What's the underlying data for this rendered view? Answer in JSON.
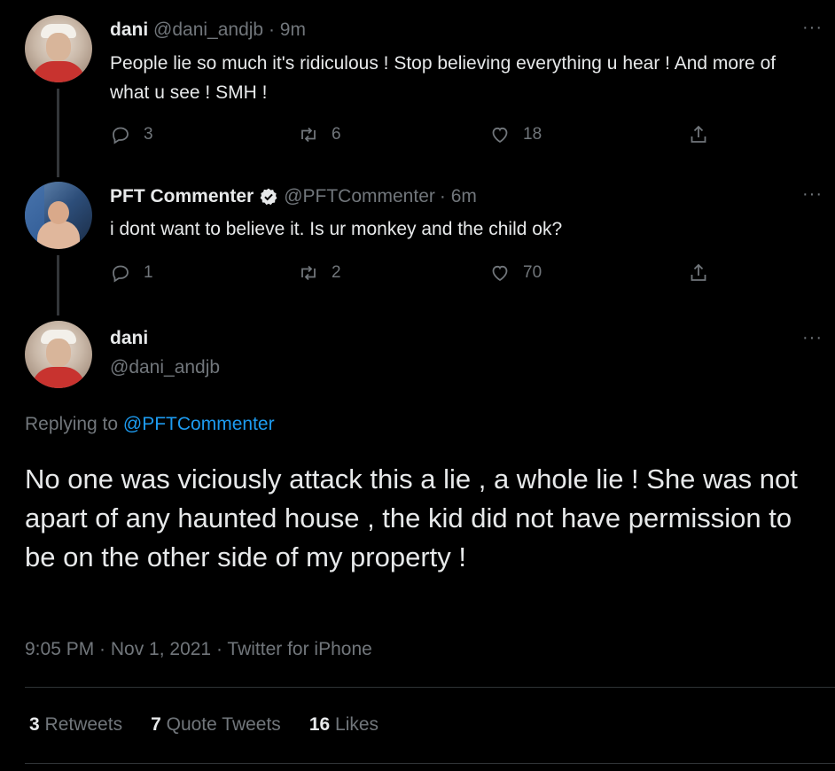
{
  "tweet1": {
    "name": "dani",
    "handle": "@dani_andjb",
    "time": "· 9m",
    "text": "People lie so much it's ridiculous ! Stop believing everything u hear ! And more of what u see ! SMH !",
    "replies": "3",
    "retweets": "6",
    "likes": "18"
  },
  "tweet2": {
    "name": "PFT Commenter",
    "handle": "@PFTCommenter",
    "time": "· 6m",
    "text": "i dont want to believe it. Is ur monkey and the child ok?",
    "replies": "1",
    "retweets": "2",
    "likes": "70"
  },
  "main": {
    "name": "dani",
    "handle": "@dani_andjb",
    "replying_prefix": "Replying to",
    "replying_to": "@PFTCommenter",
    "text": "No one was viciously attack this a lie , a whole lie ! She was not apart of any haunted house , the kid did not have permission to be on the other side of my property !",
    "meta": "9:05 PM · Nov 1, 2021 · Twitter for iPhone",
    "stats": {
      "retweets_count": "3",
      "retweets_label": "Retweets",
      "quotes_count": "7",
      "quotes_label": "Quote Tweets",
      "likes_count": "16",
      "likes_label": "Likes"
    }
  },
  "icons": {
    "more": "more-horizontal-icon",
    "reply": "reply-icon",
    "retweet": "retweet-icon",
    "like": "heart-icon",
    "share": "share-icon",
    "verified": "verified-badge-icon"
  },
  "colors": {
    "background": "#000000",
    "text": "#e7e9ea",
    "muted": "#71767b",
    "link": "#1d9bf0"
  },
  "more_label": "···"
}
